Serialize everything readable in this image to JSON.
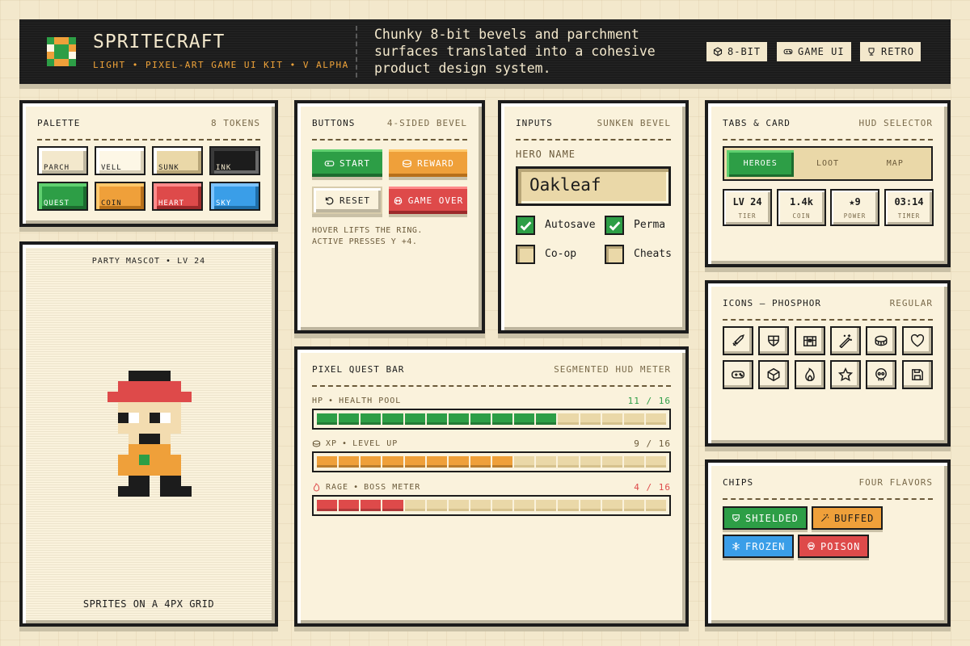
{
  "header": {
    "title": "SPRITECRAFT",
    "subtitle": "LIGHT • PIXEL-ART GAME UI KIT • V ALPHA",
    "tagline": "Chunky 8-bit bevels and parchment surfaces translated into a cohesive product design system.",
    "tags": [
      {
        "label": "8-BIT",
        "icon": "cube-icon"
      },
      {
        "label": "GAME UI",
        "icon": "gamepad-icon"
      },
      {
        "label": "RETRO",
        "icon": "trophy-icon"
      }
    ]
  },
  "palette": {
    "title": "PALETTE",
    "meta": "8 TOKENS",
    "swatches": [
      {
        "label": "PARCH",
        "color": "#f3e8cc"
      },
      {
        "label": "VELL",
        "color": "#fdf7e6"
      },
      {
        "label": "SUNK",
        "color": "#ead8a8"
      },
      {
        "label": "INK",
        "color": "#1c1c1c"
      },
      {
        "label": "QUEST",
        "color": "#2d9e46"
      },
      {
        "label": "COIN",
        "color": "#efa03a"
      },
      {
        "label": "HEART",
        "color": "#de4a4a"
      },
      {
        "label": "SKY",
        "color": "#3a9ee8"
      }
    ]
  },
  "mascot": {
    "title": "PARTY MASCOT • LV 24",
    "caption": "SPRITES ON A 4PX GRID"
  },
  "buttons": {
    "title": "BUTTONS",
    "meta": "4-SIDED BEVEL",
    "start": "START",
    "reward": "REWARD",
    "reset": "RESET",
    "game_over": "GAME OVER",
    "note_line1": "HOVER LIFTS THE RING.",
    "note_line2": "ACTIVE PRESSES Y +4."
  },
  "inputs": {
    "title": "INPUTS",
    "meta": "SUNKEN BEVEL",
    "field_label": "HERO NAME",
    "field_value": "Oakleaf",
    "checkboxes": [
      {
        "label": "Autosave",
        "checked": true
      },
      {
        "label": "Perma",
        "checked": true
      },
      {
        "label": "Co-op",
        "checked": false
      },
      {
        "label": "Cheats",
        "checked": false
      }
    ]
  },
  "tabs_card": {
    "title": "TABS & CARD",
    "meta": "HUD SELECTOR",
    "tabs": [
      "HEROES",
      "LOOT",
      "MAP"
    ],
    "active_tab": "HEROES",
    "stats": [
      {
        "value": "LV 24",
        "label": "TIER"
      },
      {
        "value": "1.4k",
        "label": "COIN"
      },
      {
        "value": "★9",
        "label": "POWER"
      },
      {
        "value": "03:14",
        "label": "TIMER"
      }
    ]
  },
  "icons": {
    "title": "ICONS — PHOSPHOR",
    "meta": "REGULAR",
    "items": [
      "sword-icon",
      "shield-icon",
      "treasure-chest-icon",
      "magic-wand-icon",
      "coin-icon",
      "heart-icon",
      "gamepad-icon",
      "cube-icon",
      "flame-icon",
      "star-icon",
      "skull-icon",
      "floppy-disk-icon"
    ]
  },
  "chips": {
    "title": "CHIPS",
    "meta": "FOUR FLAVORS",
    "items": [
      {
        "label": "SHIELDED",
        "color": "#2d9e46",
        "icon": "shield-icon"
      },
      {
        "label": "BUFFED",
        "color": "#efa03a",
        "icon": "magic-wand-icon"
      },
      {
        "label": "FROZEN",
        "color": "#3a9ee8",
        "icon": "snowflake-icon"
      },
      {
        "label": "POISON",
        "color": "#de4a4a",
        "icon": "skull-icon"
      }
    ]
  },
  "quest_bar": {
    "title": "PIXEL QUEST BAR",
    "meta": "SEGMENTED HUD METER",
    "meters": [
      {
        "name": "HP",
        "sub": "HEALTH POOL",
        "value": 11,
        "max": 16,
        "display": "11 / 16",
        "color": "#2d9e46",
        "text_color": "#2d9e46",
        "icon": ""
      },
      {
        "name": "XP",
        "sub": "LEVEL UP",
        "value": 9,
        "max": 16,
        "display": "9 / 16",
        "color": "#efa03a",
        "text_color": "#6b5a3a",
        "icon": "coin-icon"
      },
      {
        "name": "RAGE",
        "sub": "BOSS METER",
        "value": 4,
        "max": 16,
        "display": "4 / 16",
        "color": "#de4a4a",
        "text_color": "#de4a4a",
        "icon": "flame-icon"
      }
    ]
  }
}
